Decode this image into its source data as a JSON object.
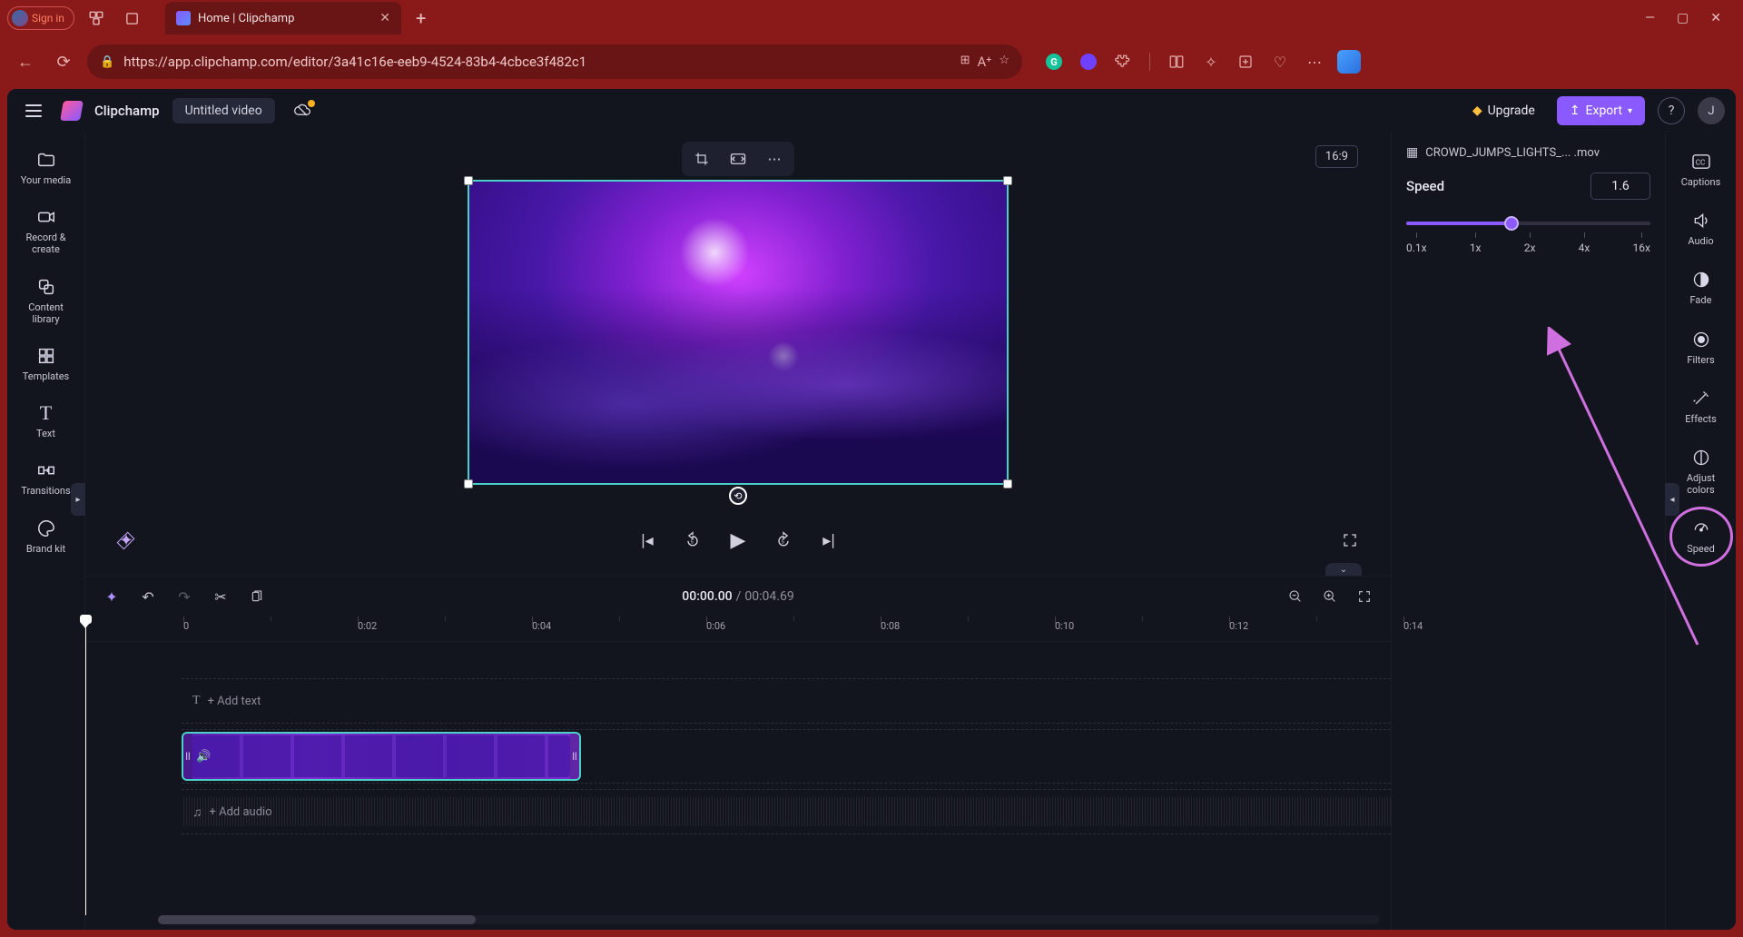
{
  "browser": {
    "profile_label": "Sign in",
    "tab_title": "Home | Clipchamp",
    "url": "https://app.clipchamp.com/editor/3a41c16e-eeb9-4524-83b4-4cbce3f482c1"
  },
  "header": {
    "app_name": "Clipchamp",
    "project_title": "Untitled video",
    "upgrade_label": "Upgrade",
    "export_label": "Export",
    "avatar_initial": "J"
  },
  "left_rail": {
    "items": [
      {
        "label": "Your media",
        "icon": "folder"
      },
      {
        "label": "Record & create",
        "icon": "camera"
      },
      {
        "label": "Content library",
        "icon": "layers"
      },
      {
        "label": "Templates",
        "icon": "grid"
      },
      {
        "label": "Text",
        "icon": "text"
      },
      {
        "label": "Transitions",
        "icon": "transition"
      },
      {
        "label": "Brand kit",
        "icon": "palette"
      }
    ]
  },
  "stage": {
    "aspect_label": "16:9"
  },
  "timeline": {
    "current_time": "00:00.00",
    "separator": "/",
    "total_time": "00:04.69",
    "ruler_start": "0",
    "ruler_marks": [
      "0:02",
      "0:04",
      "0:06",
      "0:08",
      "0:10",
      "0:12",
      "0:14"
    ],
    "add_text_hint": "+ Add text",
    "add_audio_hint": "+ Add audio"
  },
  "properties": {
    "filename": "CROWD_JUMPS_LIGHTS_... .mov",
    "speed_label": "Speed",
    "speed_value": "1.6",
    "speed_ticks": [
      "0.1x",
      "1x",
      "2x",
      "4x",
      "16x"
    ]
  },
  "right_rail": {
    "items": [
      {
        "label": "Captions",
        "icon": "cc"
      },
      {
        "label": "Audio",
        "icon": "speaker"
      },
      {
        "label": "Fade",
        "icon": "circle-half"
      },
      {
        "label": "Filters",
        "icon": "contrast"
      },
      {
        "label": "Effects",
        "icon": "wand"
      },
      {
        "label": "Adjust colors",
        "icon": "adjust"
      },
      {
        "label": "Speed",
        "icon": "gauge",
        "active": true
      }
    ]
  }
}
